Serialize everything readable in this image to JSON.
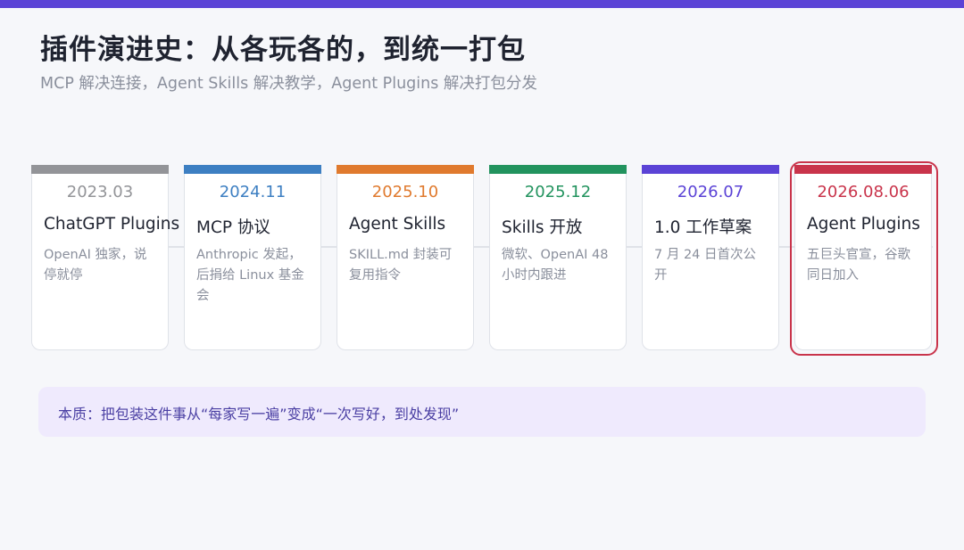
{
  "header": {
    "title": "插件演进史：从各玩各的，到统一打包",
    "subtitle": "MCP 解决连接，Agent Skills 解决教学，Agent Plugins 解决打包分发"
  },
  "timeline": [
    {
      "date": "2023.03",
      "name": "ChatGPT Plugins",
      "desc": "OpenAI 独家，说停就停",
      "color": "#939498"
    },
    {
      "date": "2024.11",
      "name": "MCP 协议",
      "desc": "Anthropic 发起，后捐给 Linux 基金会",
      "color": "#3d7fc2"
    },
    {
      "date": "2025.10",
      "name": "Agent Skills",
      "desc": "SKILL.md 封装可复用指令",
      "color": "#e07a2e"
    },
    {
      "date": "2025.12",
      "name": "Skills 开放",
      "desc": "微软、OpenAI 48 小时内跟进",
      "color": "#22935e"
    },
    {
      "date": "2026.07",
      "name": "1.0 工作草案",
      "desc": "7 月 24 日首次公开",
      "color": "#5b43d6"
    },
    {
      "date": "2026.08.06",
      "name": "Agent Plugins",
      "desc": "五巨头官宣，谷歌同日加入",
      "color": "#c9344b"
    }
  ],
  "note": {
    "text": "本质：把包装这件事从“每家写一遍”变成“一次写好，到处发现”"
  },
  "colors": {
    "accent": "#5b43d6",
    "highlight": "#c9344b"
  }
}
